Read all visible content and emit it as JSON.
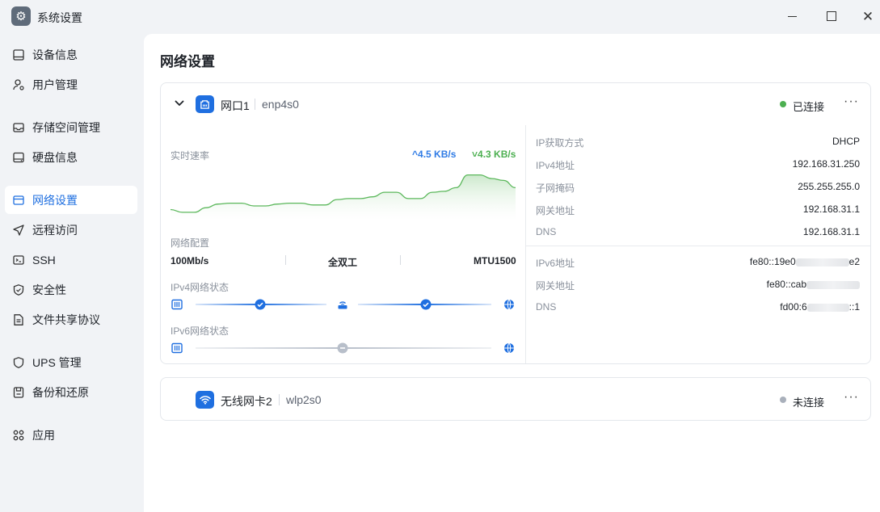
{
  "window": {
    "title": "系统设置"
  },
  "sidebar": {
    "items": [
      {
        "label": "设备信息",
        "icon": "device-icon"
      },
      {
        "label": "用户管理",
        "icon": "user-icon"
      },
      {
        "label": "存储空间管理",
        "icon": "storage-icon"
      },
      {
        "label": "硬盘信息",
        "icon": "disk-icon"
      },
      {
        "label": "网络设置",
        "icon": "network-icon",
        "active": true
      },
      {
        "label": "远程访问",
        "icon": "send-icon"
      },
      {
        "label": "SSH",
        "icon": "terminal-icon"
      },
      {
        "label": "安全性",
        "icon": "shield-icon"
      },
      {
        "label": "文件共享协议",
        "icon": "file-icon"
      },
      {
        "label": "UPS 管理",
        "icon": "ups-shield-icon"
      },
      {
        "label": "备份和还原",
        "icon": "backup-icon"
      },
      {
        "label": "应用",
        "icon": "apps-icon"
      }
    ]
  },
  "main": {
    "title": "网络设置",
    "interfaces": [
      {
        "name": "网口1",
        "device": "enp4s0",
        "status": "已连接",
        "status_color": "#4caf50",
        "expanded": true,
        "speed_label": "实时速率",
        "upload": "4.5 KB/s",
        "download": "4.3 KB/s",
        "config_label": "网络配置",
        "link_speed": "100Mb/s",
        "duplex": "全双工",
        "mtu": "MTU1500",
        "ipv4_state_label": "IPv4网络状态",
        "ipv6_state_label": "IPv6网络状态",
        "ipv4": {
          "method_label": "IP获取方式",
          "method": "DHCP",
          "addr_label": "IPv4地址",
          "addr": "192.168.31.250",
          "mask_label": "子网掩码",
          "mask": "255.255.255.0",
          "gw_label": "网关地址",
          "gw": "192.168.31.1",
          "dns_label": "DNS",
          "dns": "192.168.31.1"
        },
        "ipv6": {
          "addr_label": "IPv6地址",
          "addr_prefix": "fe80::19e0",
          "addr_suffix": "e2",
          "gw_label": "网关地址",
          "gw_prefix": "fe80::cab",
          "dns_label": "DNS",
          "dns_prefix": "fd00:6",
          "dns_suffix": "::1"
        }
      },
      {
        "name": "无线网卡2",
        "device": "wlp2s0",
        "status": "未连接",
        "status_color": "#a9b0bb",
        "expanded": false
      }
    ]
  },
  "chart_data": {
    "type": "area",
    "title": "实时速率",
    "series": [
      {
        "values": [
          12,
          9,
          9,
          14,
          18,
          19,
          19,
          16,
          16,
          18,
          19,
          19,
          17,
          17,
          23,
          24,
          24,
          26,
          31,
          31,
          24,
          24,
          31,
          32,
          36,
          50,
          50,
          46,
          44,
          36
        ]
      }
    ]
  },
  "colors": {
    "accent": "#1f6fe0",
    "upload": "#2f7be5",
    "download": "#4caf50",
    "chart_line": "#5cb85c"
  }
}
